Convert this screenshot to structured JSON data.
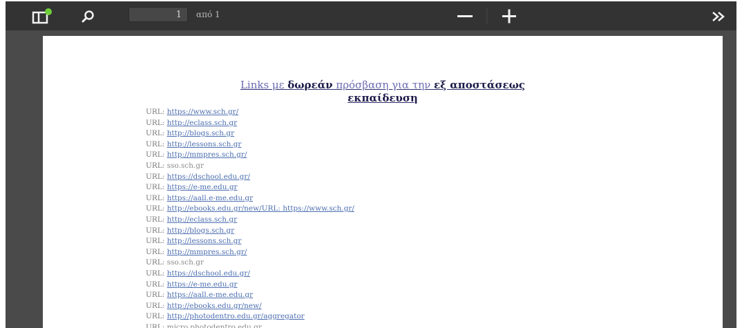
{
  "toolbar": {
    "page_current": "1",
    "page_total": "από 1"
  },
  "icons": {
    "sidebar": "sidebar-toggle-icon",
    "search": "search-icon",
    "zoom_out": "minus-icon",
    "zoom_in": "plus-icon",
    "more": "double-chevron-right-icon"
  },
  "colors": {
    "toolbar_bg": "#333333",
    "viewer_bg": "#4a4a4a",
    "page_bg": "#ffffff",
    "badge_green": "#6fcf3a",
    "link": "#4d6fb0"
  },
  "document": {
    "title": {
      "part1": "Links με ",
      "part2": "δωρεάν",
      "part3": " πρόσβαση για την ",
      "part4": "εξ αποστάσεως",
      "part5": "εκπαίδευση"
    },
    "links": [
      {
        "prefix": "URL: ",
        "text": "https://www.sch.gr/"
      },
      {
        "prefix": "URL: ",
        "text": "http://eclass.sch.gr"
      },
      {
        "prefix": "URL: ",
        "text": "http://blogs.sch.gr"
      },
      {
        "prefix": "URL: ",
        "text": "http://lessons.sch.gr"
      },
      {
        "prefix": "URL: ",
        "text": "http://mmpres.sch.gr/"
      },
      {
        "prefix": "URL: ",
        "text": "sso.sch.gr"
      },
      {
        "prefix": "URL: ",
        "text": "https://dschool.edu.gr/"
      },
      {
        "prefix": "URL: ",
        "text": "https://e-me.edu.gr"
      },
      {
        "prefix": "URL: ",
        "text": "https://aall.e-me.edu.gr"
      },
      {
        "prefix": "URL: ",
        "text": "http://ebooks.edu.gr/new/URL: https://www.sch.gr/"
      },
      {
        "prefix": "URL: ",
        "text": "http://eclass.sch.gr"
      },
      {
        "prefix": "URL: ",
        "text": "http://blogs.sch.gr"
      },
      {
        "prefix": "URL: ",
        "text": "http://lessons.sch.gr"
      },
      {
        "prefix": "URL: ",
        "text": "http://mmpres.sch.gr/"
      },
      {
        "prefix": "URL: ",
        "text": "sso.sch.gr"
      },
      {
        "prefix": "URL: ",
        "text": "https://dschool.edu.gr/"
      },
      {
        "prefix": "URL: ",
        "text": "https://e-me.edu.gr"
      },
      {
        "prefix": "URL: ",
        "text": "https://aall.e-me.edu.gr"
      },
      {
        "prefix": "URL: ",
        "text": "http://ebooks.edu.gr/new/"
      },
      {
        "prefix": "URL: ",
        "text": "http://photodentro.edu.gr/aggregator"
      },
      {
        "prefix": "URL: ",
        "text": "micro.photodentro.edu.gr"
      }
    ]
  }
}
